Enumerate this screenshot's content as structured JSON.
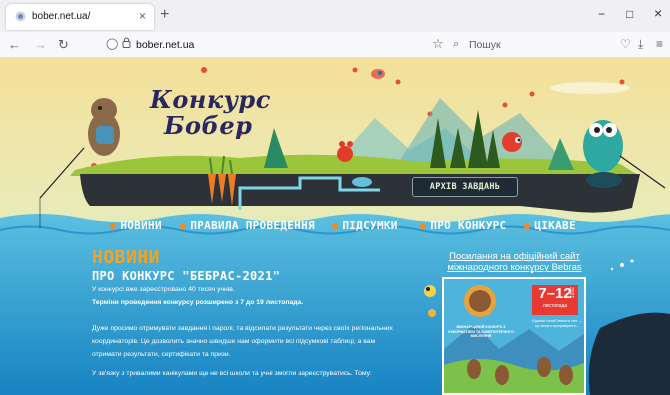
{
  "browser": {
    "tab_title": "bober.net.ua/",
    "tab_close": "×",
    "new_tab": "+",
    "url": "bober.net.ua",
    "search_placeholder": "Пошук",
    "window": {
      "minimize": "−",
      "maximize": "□",
      "close": "×"
    }
  },
  "site": {
    "title_line1": "Конкурс",
    "title_line2": "Бобер",
    "archive_button": "АРХІВ ЗАВДАНЬ",
    "menu": [
      "НОВИНИ",
      "ПРАВИЛА ПРОВЕДЕННЯ",
      "ПІДСУМКИ",
      "ПРО КОНКУРС",
      "ЦІКАВЕ"
    ]
  },
  "news": {
    "heading": "НОВИНИ",
    "article_title": "ПРО КОНКУРС \"БЕБРАС-2021\"",
    "line1": "У конкурсі вже зареєстровано 40 тисяч учнів.",
    "line2": "Терміни проведення конкурсу розширено з 7 до 19 листопада.",
    "para1_l1": "Дуже просимо отримувати завдання і паролі, та відсилати  результати через своїх регіональних",
    "para1_l2": "координаторів. Це дозволить  значно швидше нам оформити всі підсумкові таблиці, а вам",
    "para1_l3": "отримати  результати, сертифікати та призи.",
    "para2": "У зв'язку з тривалими канікулами ще не всі школи та учні змогли зареєструватись. Тому:"
  },
  "sidebar": {
    "link_line1": "Посилання на офіційний сайт",
    "link_line2": "міжнародного конкурсу Bebras"
  },
  "poster": {
    "dates": "7–12",
    "month": "листопада",
    "year": "2021",
    "org": "МІЖНАРОДНИЙ КОНКУРС З ІНФОРМАТИКИ ТА КОМП'ЮТЕРНОГО МИСЛЕННЯ",
    "note": "Єдиний спосіб змінити світ — це почати програмувати..."
  },
  "colors": {
    "sky_top": "#f7e7a6",
    "sky_mid": "#bfe3d5",
    "water": "#35a8d6",
    "water_deep": "#1a86c2",
    "accent_orange": "#f6a21e",
    "title": "#2a2760"
  }
}
